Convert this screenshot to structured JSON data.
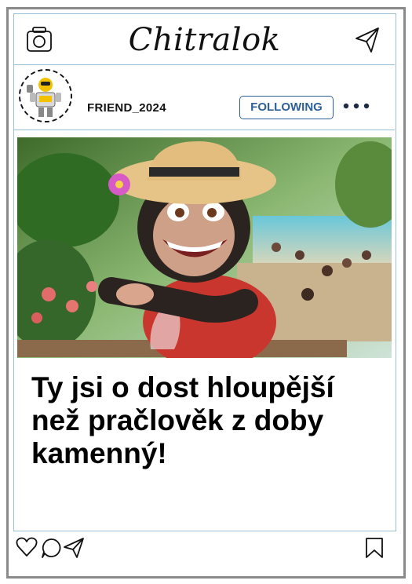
{
  "app": {
    "name": "Chitralok"
  },
  "icons": {
    "camera": "camera-icon",
    "send": "send-icon",
    "more": "more-icon",
    "like": "heart-icon",
    "comment": "comment-icon",
    "share": "share-icon",
    "save": "bookmark-icon"
  },
  "post": {
    "username": "FRIEND_2024",
    "follow_label": "FOLLOWING",
    "caption": "Ty jsi o dost hloupější než pračlověk z doby kamenný!"
  },
  "colors": {
    "accent": "#2d5f9a",
    "frame": "#8a8a8a",
    "divider": "#9bbfd6"
  }
}
